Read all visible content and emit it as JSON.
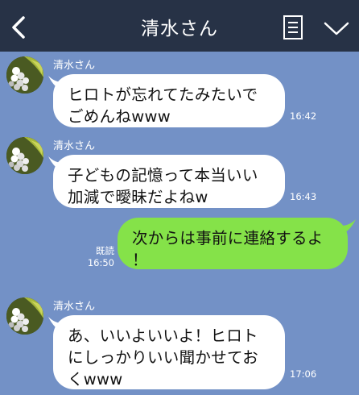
{
  "header": {
    "title": "清水さん",
    "back_icon": "chevron-left-icon",
    "memo_icon": "note-icon",
    "menu_icon": "chevron-down-icon",
    "bg": "#273246"
  },
  "chat": {
    "bg": "#7391c6",
    "incoming_bubble": "#ffffff",
    "outgoing_bubble": "#85e249",
    "messages": [
      {
        "sender": "清水さん",
        "lines": [
          "ヒロトが忘れてたみたいで",
          "ごめんねwww"
        ],
        "time": "16:42"
      },
      {
        "sender": "清水さん",
        "lines": [
          "子どもの記憶って本当いい",
          "加減で曖昧だよねw"
        ],
        "time": "16:43"
      },
      {
        "lines": [
          "次からは事前に連絡するよ",
          "！"
        ],
        "read": "既読",
        "time": "16:50"
      },
      {
        "sender": "清水さん",
        "lines": [
          "あ、いいよいいよ！ヒロト",
          "にしっかりいい聞かせてお",
          "くwww"
        ],
        "time": "17:06"
      }
    ]
  }
}
